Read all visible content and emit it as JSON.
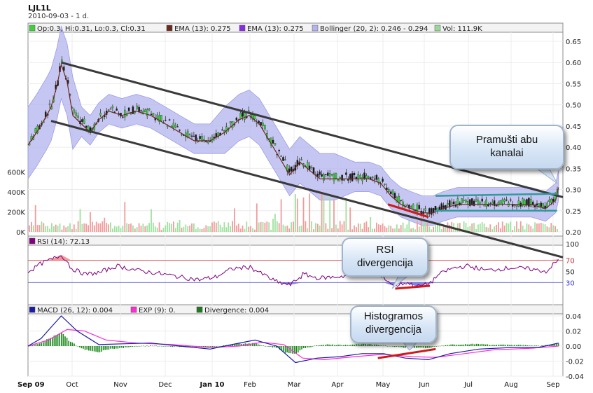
{
  "header": {
    "symbol": "LJL1L",
    "subtitle": "2010-09-03 - 1 d."
  },
  "chart_data": [
    {
      "type": "candlestick",
      "panel": "price",
      "legend": [
        {
          "label": "Op:0.3, Hi:0.31, Lo:0.3, Cl:0.31",
          "color": "#3bd23b"
        },
        {
          "label": "EMA (13): 0.275",
          "color": "#6b2a1e"
        },
        {
          "label": "EMA (13): 0.275",
          "color": "#8a2be2"
        },
        {
          "label": "Bollinger (20, 2): 0.246 - 0.294",
          "color": "#b4b4f0"
        },
        {
          "label": "Vol: 111.9K",
          "color": "#9ad89a"
        }
      ],
      "y_ticks": [
        "0.65",
        "0.60",
        "0.55",
        "0.50",
        "0.45",
        "0.40",
        "0.35",
        "0.30",
        "0.25",
        "0.20"
      ],
      "ylim": [
        0.2,
        0.65
      ],
      "volume_ticks": [
        "600K",
        "400K",
        "200K",
        "0K"
      ],
      "volume_lim": [
        0,
        700000
      ],
      "x_ticks": [
        "Sep 09",
        "Oct",
        "Nov",
        "Dec",
        "Jan 10",
        "Feb",
        "Mar",
        "Apr",
        "May",
        "Jun",
        "Jul",
        "Aug",
        "Sep"
      ],
      "close_path": [
        [
          "2009-09-01",
          0.41
        ],
        [
          "2009-09-07",
          0.44
        ],
        [
          "2009-09-14",
          0.48
        ],
        [
          "2009-09-17",
          0.5
        ],
        [
          "2009-09-21",
          0.55
        ],
        [
          "2009-09-24",
          0.6
        ],
        [
          "2009-09-28",
          0.56
        ],
        [
          "2009-10-02",
          0.48
        ],
        [
          "2009-10-08",
          0.46
        ],
        [
          "2009-10-14",
          0.44
        ],
        [
          "2009-10-20",
          0.47
        ],
        [
          "2009-10-27",
          0.49
        ],
        [
          "2009-11-05",
          0.48
        ],
        [
          "2009-11-15",
          0.49
        ],
        [
          "2009-11-25",
          0.48
        ],
        [
          "2009-12-05",
          0.46
        ],
        [
          "2009-12-15",
          0.44
        ],
        [
          "2009-12-25",
          0.42
        ],
        [
          "2010-01-05",
          0.42
        ],
        [
          "2010-01-15",
          0.44
        ],
        [
          "2010-01-25",
          0.47
        ],
        [
          "2010-02-01",
          0.48
        ],
        [
          "2010-02-08",
          0.46
        ],
        [
          "2010-02-15",
          0.42
        ],
        [
          "2010-02-22",
          0.38
        ],
        [
          "2010-03-01",
          0.34
        ],
        [
          "2010-03-08",
          0.37
        ],
        [
          "2010-03-15",
          0.35
        ],
        [
          "2010-03-22",
          0.33
        ],
        [
          "2010-04-01",
          0.33
        ],
        [
          "2010-04-15",
          0.33
        ],
        [
          "2010-04-25",
          0.33
        ],
        [
          "2010-05-03",
          0.32
        ],
        [
          "2010-05-10",
          0.29
        ],
        [
          "2010-05-17",
          0.27
        ],
        [
          "2010-05-24",
          0.26
        ],
        [
          "2010-06-01",
          0.25
        ],
        [
          "2010-06-08",
          0.25
        ],
        [
          "2010-06-15",
          0.26
        ],
        [
          "2010-06-25",
          0.27
        ],
        [
          "2010-07-05",
          0.27
        ],
        [
          "2010-07-20",
          0.27
        ],
        [
          "2010-08-01",
          0.27
        ],
        [
          "2010-08-15",
          0.27
        ],
        [
          "2010-08-25",
          0.26
        ],
        [
          "2010-09-01",
          0.28
        ],
        [
          "2010-09-03",
          0.31
        ]
      ],
      "trend_lines": [
        {
          "from": [
            "2009-09-24",
            0.6
          ],
          "to": [
            "2010-09-06",
            0.282
          ]
        },
        {
          "from": [
            "2009-09-17",
            0.462
          ],
          "to": [
            "2010-09-06",
            0.14
          ]
        }
      ],
      "channel_lines": [
        {
          "from": [
            "2010-06-10",
            0.285
          ],
          "to": [
            "2010-09-02",
            0.29
          ]
        },
        {
          "from": [
            "2010-06-10",
            0.25
          ],
          "to": [
            "2010-09-02",
            0.25
          ]
        }
      ],
      "divergence_line": {
        "from": [
          "2010-05-08",
          0.265
        ],
        "to": [
          "2010-06-05",
          0.235
        ]
      }
    },
    {
      "type": "line",
      "panel": "rsi",
      "legend": [
        {
          "label": "RSI (14): 72.13",
          "color": "#800080"
        }
      ],
      "y_ticks": [
        "100",
        "70",
        "50",
        "30"
      ],
      "ylim": [
        0,
        100
      ],
      "levels": [
        70,
        30
      ],
      "series": [
        [
          "2009-09-01",
          50
        ],
        [
          "2009-09-10",
          65
        ],
        [
          "2009-09-17",
          72
        ],
        [
          "2009-09-24",
          80
        ],
        [
          "2009-10-01",
          55
        ],
        [
          "2009-10-10",
          45
        ],
        [
          "2009-10-20",
          48
        ],
        [
          "2009-11-01",
          60
        ],
        [
          "2009-11-15",
          52
        ],
        [
          "2009-12-01",
          46
        ],
        [
          "2009-12-15",
          40
        ],
        [
          "2009-12-28",
          35
        ],
        [
          "2010-01-08",
          40
        ],
        [
          "2010-01-20",
          55
        ],
        [
          "2010-02-01",
          58
        ],
        [
          "2010-02-10",
          45
        ],
        [
          "2010-02-20",
          30
        ],
        [
          "2010-03-01",
          26
        ],
        [
          "2010-03-10",
          45
        ],
        [
          "2010-03-20",
          38
        ],
        [
          "2010-04-01",
          40
        ],
        [
          "2010-04-15",
          44
        ],
        [
          "2010-04-25",
          47
        ],
        [
          "2010-05-05",
          38
        ],
        [
          "2010-05-12",
          24
        ],
        [
          "2010-05-20",
          30
        ],
        [
          "2010-05-28",
          23
        ],
        [
          "2010-06-05",
          28
        ],
        [
          "2010-06-12",
          45
        ],
        [
          "2010-06-20",
          55
        ],
        [
          "2010-07-01",
          60
        ],
        [
          "2010-07-15",
          52
        ],
        [
          "2010-08-01",
          57
        ],
        [
          "2010-08-15",
          54
        ],
        [
          "2010-08-25",
          50
        ],
        [
          "2010-09-03",
          72
        ]
      ],
      "divergence_line": {
        "from": [
          "2010-05-13",
          19
        ],
        "to": [
          "2010-06-06",
          24
        ]
      }
    },
    {
      "type": "line",
      "panel": "macd",
      "legend": [
        {
          "label": "MACD (26, 12): 0.004",
          "color": "#1a1aa6"
        },
        {
          "label": "EXP (9): 0.",
          "color": "#ff2dd2"
        },
        {
          "label": "Divergence: 0.004",
          "color": "#1e7a1e"
        }
      ],
      "y_ticks": [
        "0.04",
        "0.02",
        "0.00",
        "-0.02",
        "-0.04"
      ],
      "ylim": [
        -0.04,
        0.05
      ],
      "macd": [
        [
          "2009-09-01",
          0.0
        ],
        [
          "2009-09-10",
          0.01
        ],
        [
          "2009-09-17",
          0.025
        ],
        [
          "2009-09-24",
          0.04
        ],
        [
          "2009-10-05",
          0.02
        ],
        [
          "2009-10-20",
          0.002
        ],
        [
          "2009-11-05",
          0.003
        ],
        [
          "2009-11-25",
          0.004
        ],
        [
          "2009-12-15",
          0.0
        ],
        [
          "2010-01-05",
          -0.004
        ],
        [
          "2010-01-20",
          0.002
        ],
        [
          "2010-02-05",
          0.008
        ],
        [
          "2010-02-20",
          0.0
        ],
        [
          "2010-03-05",
          -0.022
        ],
        [
          "2010-03-20",
          -0.016
        ],
        [
          "2010-04-05",
          -0.014
        ],
        [
          "2010-04-20",
          -0.01
        ],
        [
          "2010-05-05",
          -0.01
        ],
        [
          "2010-05-20",
          -0.016
        ],
        [
          "2010-06-05",
          -0.018
        ],
        [
          "2010-06-20",
          -0.01
        ],
        [
          "2010-07-10",
          -0.004
        ],
        [
          "2010-08-01",
          -0.002
        ],
        [
          "2010-08-20",
          -0.002
        ],
        [
          "2010-09-03",
          0.004
        ]
      ],
      "signal": [
        [
          "2009-09-01",
          0.0
        ],
        [
          "2009-09-15",
          0.008
        ],
        [
          "2009-09-28",
          0.022
        ],
        [
          "2009-10-10",
          0.02
        ],
        [
          "2009-10-25",
          0.008
        ],
        [
          "2009-11-15",
          0.004
        ],
        [
          "2009-12-10",
          0.002
        ],
        [
          "2010-01-05",
          -0.002
        ],
        [
          "2010-01-25",
          0.0
        ],
        [
          "2010-02-10",
          0.005
        ],
        [
          "2010-02-25",
          0.002
        ],
        [
          "2010-03-10",
          -0.016
        ],
        [
          "2010-03-25",
          -0.018
        ],
        [
          "2010-04-15",
          -0.014
        ],
        [
          "2010-05-05",
          -0.011
        ],
        [
          "2010-05-25",
          -0.014
        ],
        [
          "2010-06-10",
          -0.015
        ],
        [
          "2010-06-30",
          -0.01
        ],
        [
          "2010-07-20",
          -0.005
        ],
        [
          "2010-08-15",
          -0.003
        ],
        [
          "2010-09-03",
          0.0
        ]
      ],
      "divergence_line": {
        "from": [
          "2010-05-01",
          -0.016
        ],
        "to": [
          "2010-06-10",
          -0.004
        ]
      }
    }
  ],
  "annotations": {
    "channels": [
      "Pramušti abu",
      "kanalai"
    ],
    "rsi": [
      "RSI",
      "divergencija"
    ],
    "histogram": [
      "Histogramos",
      "divergencija"
    ]
  },
  "colors": {
    "frame": "#8c8c8c",
    "trend": "#3a3a3a",
    "channel": "#2f9b9b",
    "divergence": "#d01818",
    "bollinger": "#b3b3ee",
    "up": "#3bd23b",
    "down": "#1a1a1a"
  }
}
